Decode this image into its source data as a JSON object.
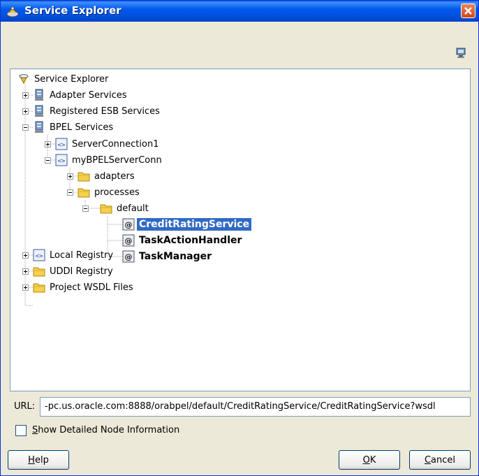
{
  "window": {
    "title": "Service Explorer"
  },
  "tree": {
    "root": "Service Explorer",
    "adapter_services": "Adapter Services",
    "registered_esb": "Registered ESB Services",
    "bpel_services": "BPEL Services",
    "server_connection1": "ServerConnection1",
    "mybpel_server_conn": "myBPELServerConn",
    "adapters": "adapters",
    "processes": "processes",
    "default": "default",
    "credit_rating": "CreditRatingService",
    "task_action": "TaskActionHandler",
    "task_manager": "TaskManager",
    "local_registry": "Local Registry",
    "uddi_registry": "UDDI Registry",
    "project_wsdl": "Project WSDL Files"
  },
  "url": {
    "label": "URL:",
    "value": "-pc.us.oracle.com:8888/orabpel/default/CreditRatingService/CreditRatingService?wsdl"
  },
  "checkbox": {
    "label_first": "S",
    "label_rest": "how Detailed Node Information",
    "checked": false
  },
  "buttons": {
    "help_u": "H",
    "help_rest": "elp",
    "ok_u": "O",
    "ok_rest": "K",
    "cancel_u": "C",
    "cancel_rest": "ancel"
  },
  "colors": {
    "title_blue": "#0058EE",
    "selection": "#316AC5",
    "dialog_bg": "#ECE9D8"
  }
}
